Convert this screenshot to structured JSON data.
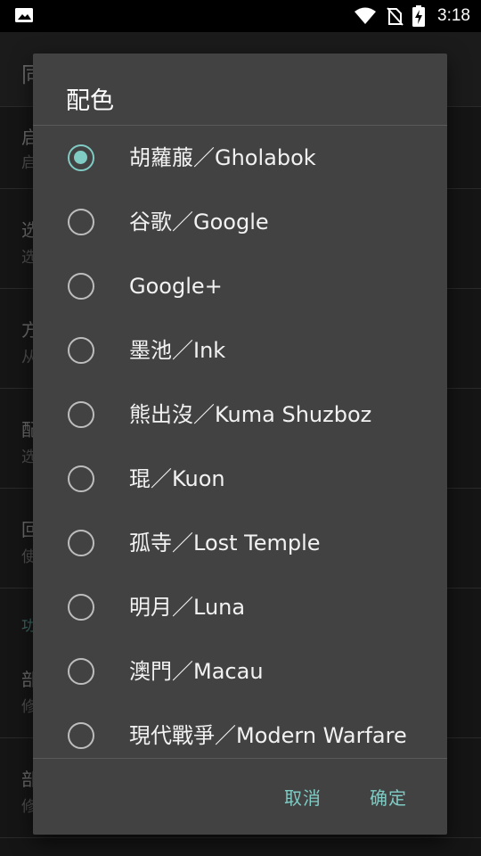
{
  "status_bar": {
    "time": "3:18",
    "icons": [
      "image-icon",
      "wifi-icon",
      "no-sim-icon",
      "battery-charging-icon"
    ]
  },
  "background": {
    "header_glyph": "同",
    "rows": [
      {
        "title": "启",
        "subtitle": "启"
      },
      {
        "title": "选",
        "subtitle": "选"
      },
      {
        "title": "方",
        "subtitle": "从"
      },
      {
        "title": "配",
        "subtitle": "选"
      },
      {
        "title": "回",
        "subtitle": "使"
      }
    ],
    "section_label": "功",
    "rows2": [
      {
        "title": "部",
        "subtitle": "修"
      },
      {
        "title": "部",
        "subtitle": "修"
      }
    ]
  },
  "dialog": {
    "title": "配色",
    "options": [
      {
        "label": "胡蘿菔／Gholabok",
        "checked": true
      },
      {
        "label": "谷歌／Google",
        "checked": false
      },
      {
        "label": "Google+",
        "checked": false
      },
      {
        "label": "墨池／Ink",
        "checked": false
      },
      {
        "label": "熊出沒／Kuma Shuzboz",
        "checked": false
      },
      {
        "label": "琨／Kuon",
        "checked": false
      },
      {
        "label": "孤寺／Lost Temple",
        "checked": false
      },
      {
        "label": "明月／Luna",
        "checked": false
      },
      {
        "label": "澳門／Macau",
        "checked": false
      },
      {
        "label": "現代戰爭／Modern Warfare",
        "checked": false
      }
    ],
    "cancel_label": "取消",
    "confirm_label": "确定"
  },
  "colors": {
    "accent": "#80cbc4",
    "dialog_bg": "#424242"
  }
}
